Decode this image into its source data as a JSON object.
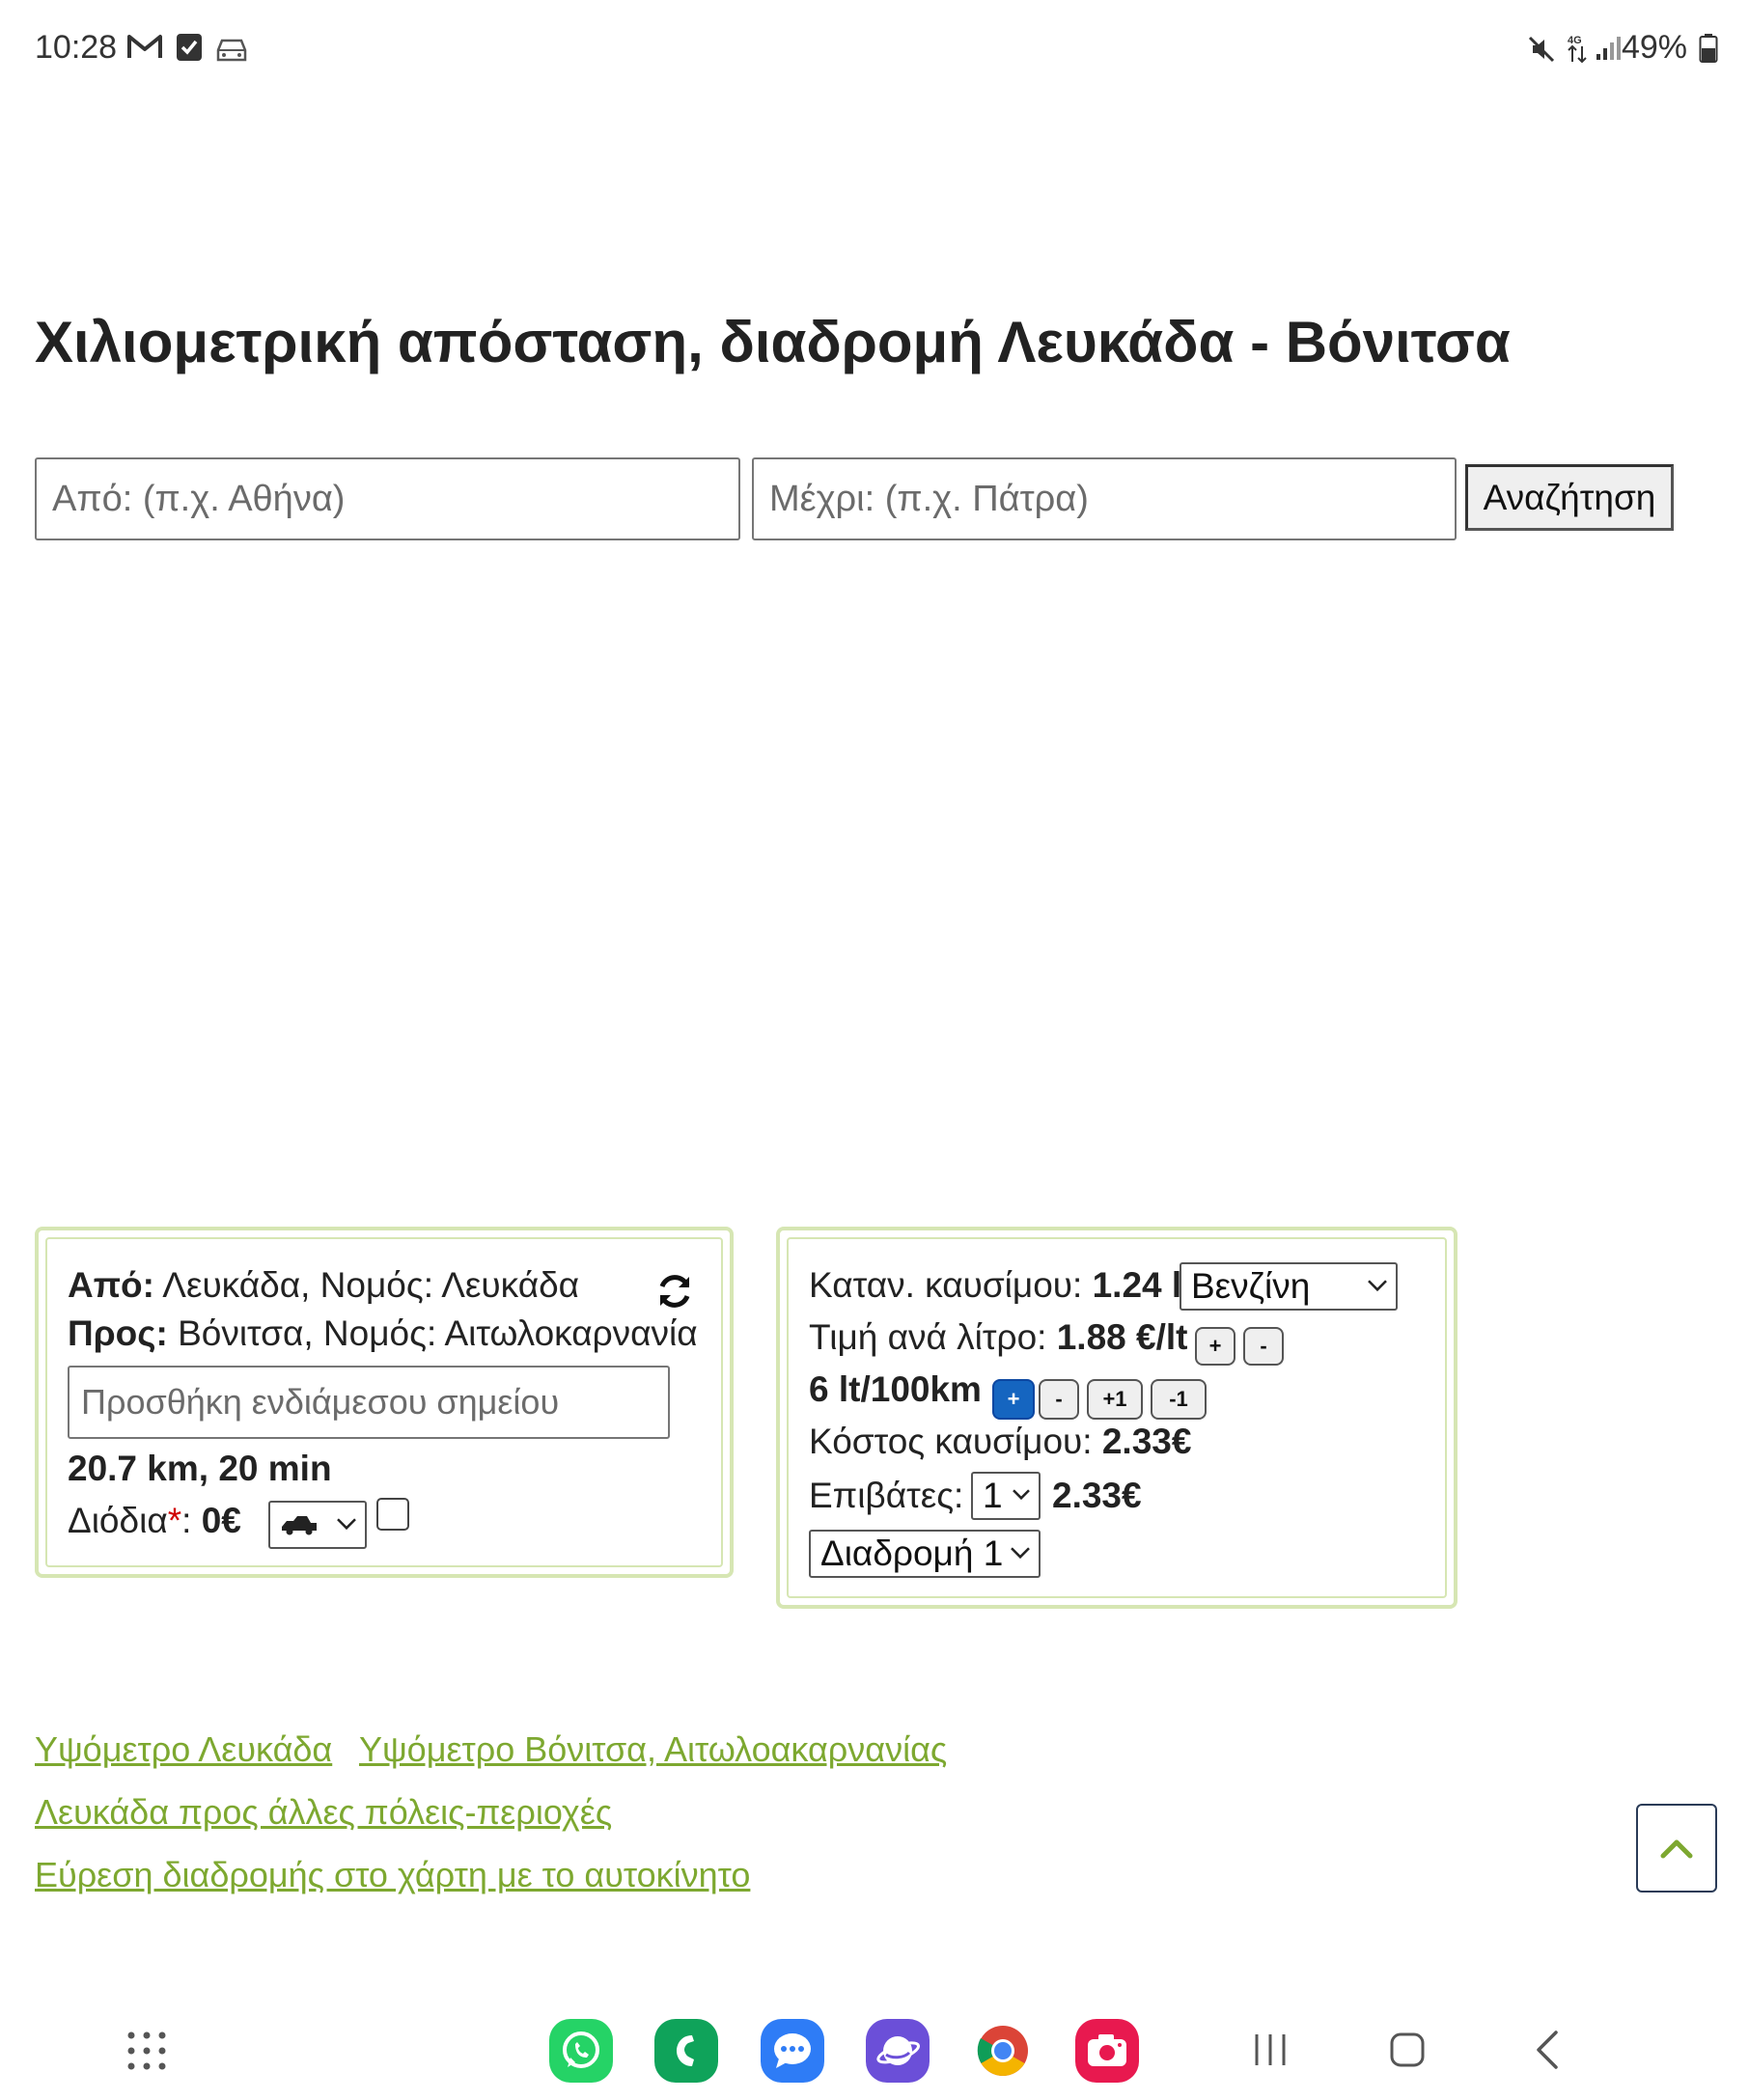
{
  "status_bar": {
    "time": "10:28",
    "battery": "49%",
    "network": "4G",
    "icons": [
      "gmail-icon",
      "checkbox-notification-icon",
      "car-icon",
      "mute-icon",
      "data-arrows-icon",
      "signal-icon",
      "battery-icon"
    ]
  },
  "page": {
    "title": "Χιλιομετρική απόσταση, διαδρομή Λευκάδα - Βόνιτσα"
  },
  "search": {
    "from_placeholder": "Από: (π.χ. Αθήνα)",
    "to_placeholder": "Μέχρι: (π.χ. Πάτρα)",
    "button_label": "Αναζήτηση"
  },
  "route": {
    "from_label": "Από:",
    "from_value": "Λευκάδα, Νομός: Λευκάδα",
    "to_label": "Προς:",
    "to_value": "Βόνιτσα, Νομός: Αιτωλοκαρνανία",
    "waypoint_placeholder": "Προσθήκη ενδιάμεσου σημείου",
    "distance_time": "20.7 km, 20 min",
    "tolls_label": "Διόδια",
    "tolls_asterisk": "*",
    "tolls_colon": ":",
    "tolls_value": "0€",
    "vehicle_select": "car-icon"
  },
  "cost": {
    "consumption_label": "Καταν. καυσίμου:",
    "consumption_value": "1.24 lt",
    "fuel_type": "Βενζίνη",
    "price_label": "Τιμή ανά λίτρο:",
    "price_value": "1.88 €/lt",
    "price_plus": "+",
    "price_minus": "-",
    "efficiency": "6 lt/100km",
    "eff_plus": "+",
    "eff_minus": "-",
    "eff_plus_one": "+1",
    "eff_minus_one": "-1",
    "fuel_cost_label": "Κόστος καυσίμου:",
    "fuel_cost_value": "2.33€",
    "passengers_label": "Επιβάτες:",
    "passengers_value": "1",
    "per_person_cost": "2.33€",
    "route_select": "Διαδρομή 1"
  },
  "links": {
    "elevation_lefkada": "Υψόμετρο Λευκάδα",
    "elevation_vonitsa": "Υψόμετρο Βόνιτσα, Αιτωλοακαρνανίας",
    "other_cities": "Λευκάδα προς άλλες πόλεις-περιοχές",
    "find_route": "Εύρεση διαδρομής στο χάρτη με το αυτοκίνητο"
  },
  "colors": {
    "panel_border": "#d6e6b3",
    "link": "#7da830",
    "active_button": "#1565c0"
  },
  "dock": {
    "apps": [
      "whatsapp-icon",
      "phone-icon",
      "messages-icon",
      "internet-browser-icon",
      "chrome-icon",
      "camera-icon"
    ],
    "nav": [
      "recent-apps-icon",
      "home-icon",
      "back-icon"
    ]
  }
}
